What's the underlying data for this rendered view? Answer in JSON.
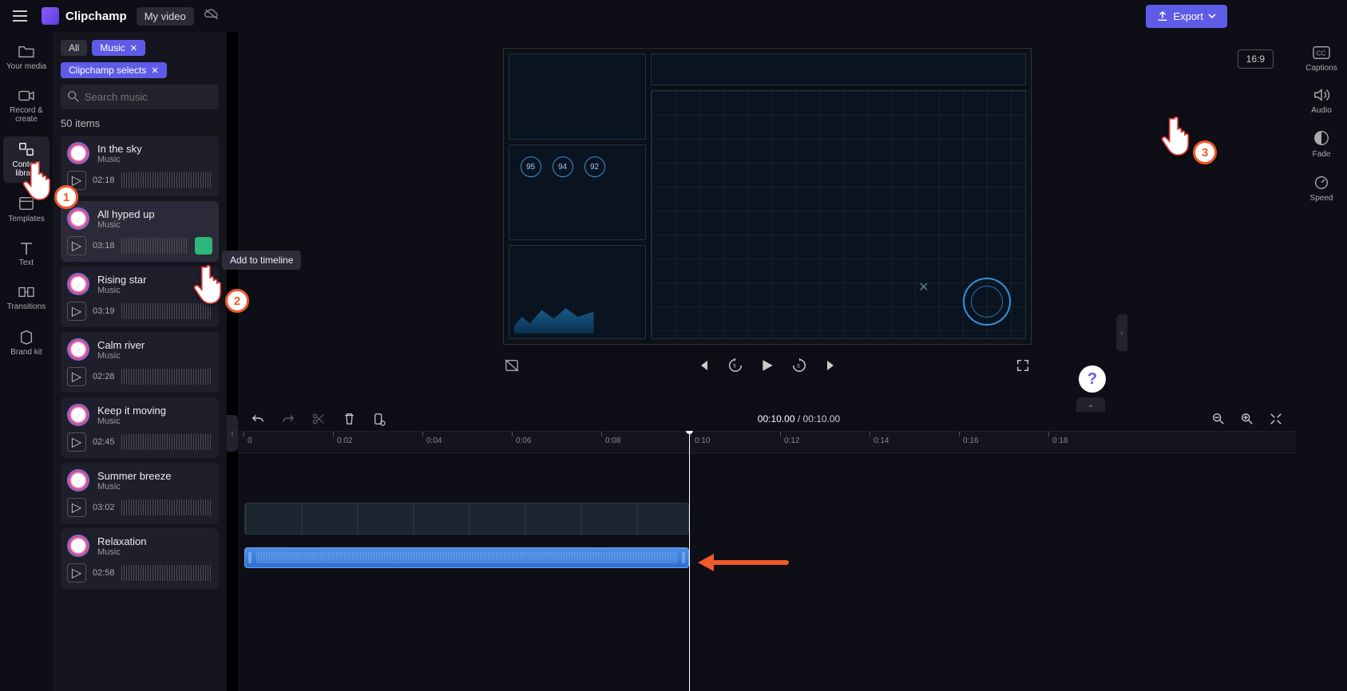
{
  "app": {
    "name": "Clipchamp",
    "project": "My video"
  },
  "export_label": "Export",
  "leftnav": [
    {
      "id": "your-media",
      "label": "Your media"
    },
    {
      "id": "record-create",
      "label": "Record & create"
    },
    {
      "id": "content-library",
      "label": "Content library"
    },
    {
      "id": "templates",
      "label": "Templates"
    },
    {
      "id": "text",
      "label": "Text"
    },
    {
      "id": "transitions",
      "label": "Transitions"
    },
    {
      "id": "brand-kit",
      "label": "Brand kit"
    }
  ],
  "library": {
    "filters": {
      "all": "All",
      "music": "Music",
      "selects": "Clipchamp selects"
    },
    "search_placeholder": "Search music",
    "count_label": "50 items",
    "tooltip_add": "Add to timeline",
    "items": [
      {
        "title": "In the sky",
        "sub": "Music",
        "duration": "02:18"
      },
      {
        "title": "All hyped up",
        "sub": "Music",
        "duration": "03:18"
      },
      {
        "title": "Rising star",
        "sub": "Music",
        "duration": "03:19"
      },
      {
        "title": "Calm river",
        "sub": "Music",
        "duration": "02:28"
      },
      {
        "title": "Keep it moving",
        "sub": "Music",
        "duration": "02:45"
      },
      {
        "title": "Summer breeze",
        "sub": "Music",
        "duration": "03:02"
      },
      {
        "title": "Relaxation",
        "sub": "Music",
        "duration": "02:58"
      }
    ]
  },
  "preview": {
    "aspect": "16:9",
    "hud_numbers": [
      "95",
      "94",
      "92"
    ]
  },
  "rightnav": [
    {
      "id": "captions",
      "label": "Captions"
    },
    {
      "id": "audio",
      "label": "Audio"
    },
    {
      "id": "fade",
      "label": "Fade"
    },
    {
      "id": "speed",
      "label": "Speed"
    }
  ],
  "timeline": {
    "current": "00:10.00",
    "total": "00:10.00",
    "ticks": [
      "0",
      "0:02",
      "0:04",
      "0:06",
      "0:08",
      "0:10",
      "0:12",
      "0:14",
      "0:16",
      "0:18"
    ]
  },
  "annotations": {
    "n1": "1",
    "n2": "2",
    "n3": "3"
  }
}
